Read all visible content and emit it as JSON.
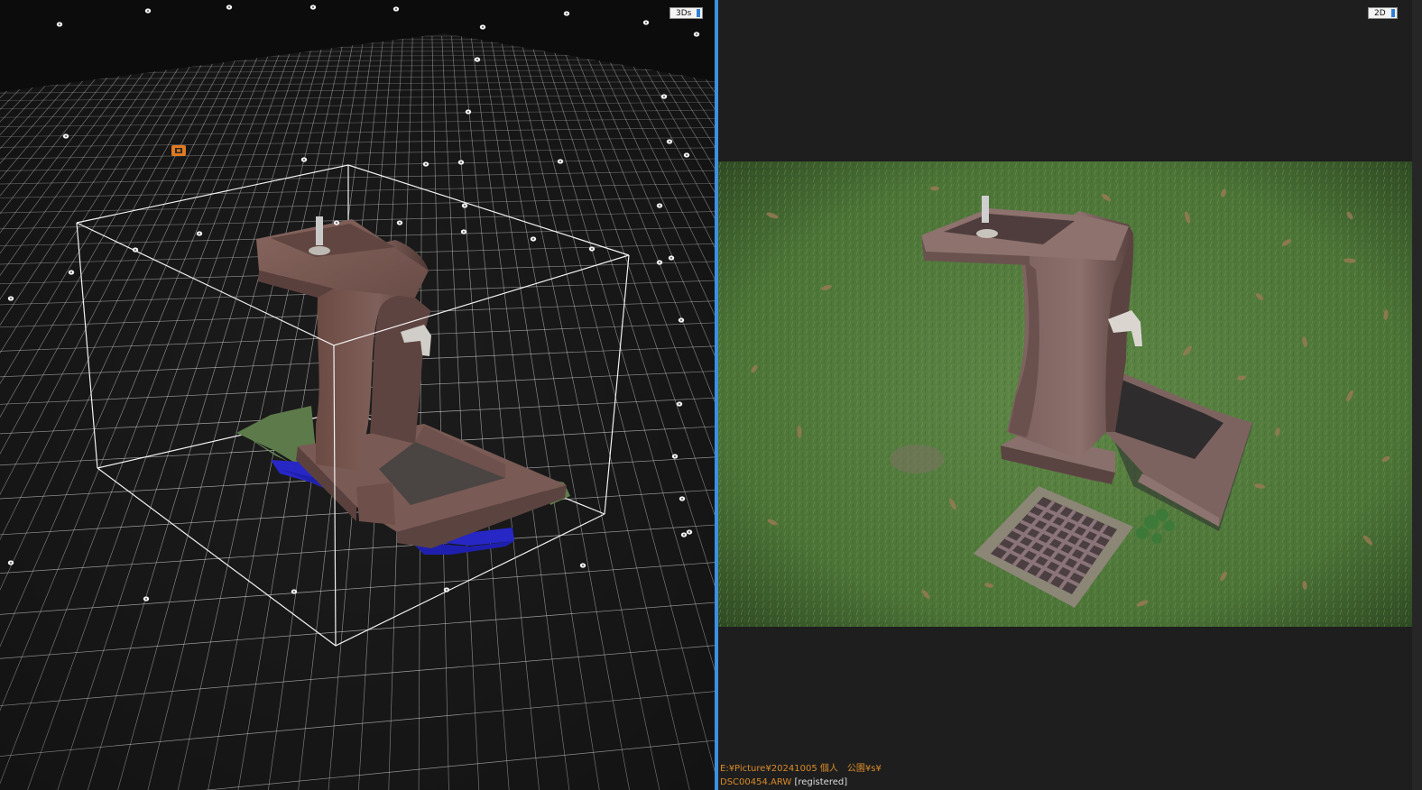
{
  "views": {
    "left": {
      "label": "3Ds"
    },
    "right": {
      "label": "2D"
    }
  },
  "file": {
    "path": "E:¥Picture¥20241005 個人　公園¥s¥",
    "name": "DSC00454.ARW",
    "status": "[registered]"
  },
  "colors": {
    "accent": "#3d8fe0",
    "path_text": "#d88a2a",
    "status_text": "#dddddd",
    "grid": "#ffffff",
    "ground_mesh": "#2a28c8"
  },
  "icons": {
    "camera": "camera-icon",
    "selected_camera": "selected-camera-icon"
  }
}
